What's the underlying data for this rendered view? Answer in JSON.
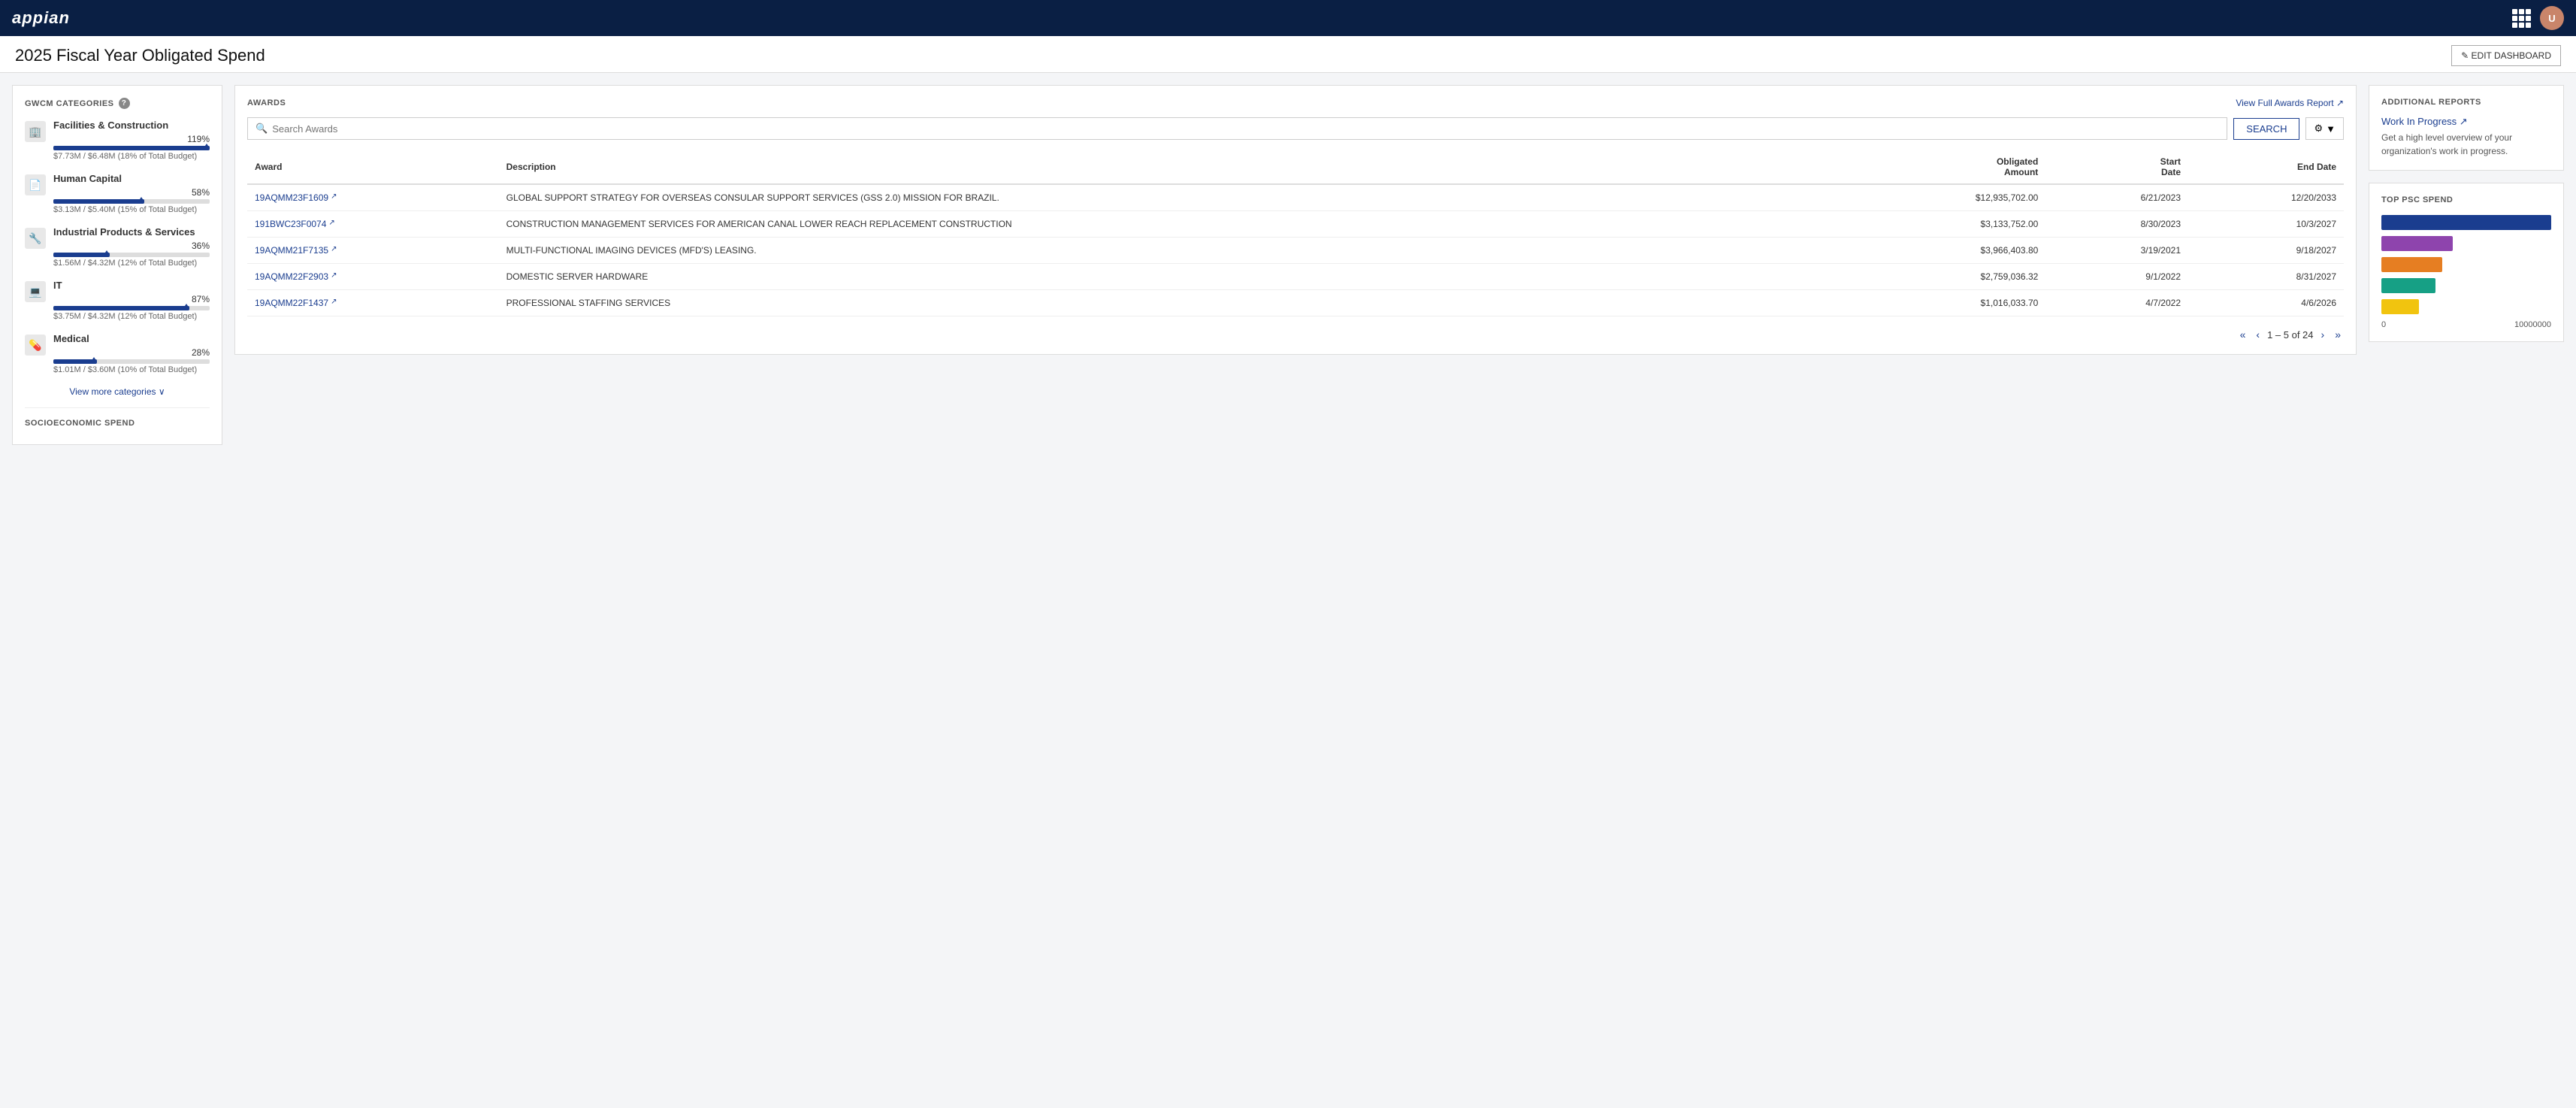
{
  "topnav": {
    "logo": "appian",
    "avatar_initials": "U"
  },
  "page": {
    "title": "2025 Fiscal Year Obligated Spend",
    "edit_dashboard_label": "✎ EDIT DASHBOARD"
  },
  "left_panel": {
    "categories_title": "GWCM CATEGORIES",
    "categories": [
      {
        "icon": "🏢",
        "name": "Facilities & Construction",
        "percent": 119,
        "percent_label": "119%",
        "budget": "$7.73M / $6.48M (18% of Total Budget)"
      },
      {
        "icon": "📄",
        "name": "Human Capital",
        "percent": 58,
        "percent_label": "58%",
        "budget": "$3.13M / $5.40M (15% of Total Budget)"
      },
      {
        "icon": "🔧",
        "name": "Industrial Products & Services",
        "percent": 36,
        "percent_label": "36%",
        "budget": "$1.56M / $4.32M (12% of Total Budget)"
      },
      {
        "icon": "💻",
        "name": "IT",
        "percent": 87,
        "percent_label": "87%",
        "budget": "$3.75M / $4.32M (12% of Total Budget)"
      },
      {
        "icon": "💊",
        "name": "Medical",
        "percent": 28,
        "percent_label": "28%",
        "budget": "$1.01M / $3.60M (10% of Total Budget)"
      }
    ],
    "view_more_label": "View more categories ∨",
    "socio_title": "SOCIOECONOMIC SPEND"
  },
  "awards_panel": {
    "title": "AWARDS",
    "view_full_label": "View Full Awards Report ↗",
    "search_placeholder": "Search Awards",
    "search_button_label": "SEARCH",
    "filter_button_label": "▼",
    "table": {
      "headers": [
        "Award",
        "Description",
        "Obligated Amount",
        "Start Date",
        "End Date"
      ],
      "rows": [
        {
          "award_id": "19AQMM23F1609",
          "description": "GLOBAL SUPPORT STRATEGY FOR OVERSEAS CONSULAR SUPPORT SERVICES (GSS 2.0) MISSION FOR BRAZIL.",
          "obligated_amount": "$12,935,702.00",
          "start_date": "6/21/2023",
          "end_date": "12/20/2033"
        },
        {
          "award_id": "191BWC23F0074",
          "description": "CONSTRUCTION MANAGEMENT SERVICES FOR AMERICAN CANAL LOWER REACH REPLACEMENT CONSTRUCTION",
          "obligated_amount": "$3,133,752.00",
          "start_date": "8/30/2023",
          "end_date": "10/3/2027"
        },
        {
          "award_id": "19AQMM21F7135",
          "description": "MULTI-FUNCTIONAL IMAGING DEVICES (MFD'S) LEASING.",
          "obligated_amount": "$3,966,403.80",
          "start_date": "3/19/2021",
          "end_date": "9/18/2027"
        },
        {
          "award_id": "19AQMM22F2903",
          "description": "DOMESTIC SERVER HARDWARE",
          "obligated_amount": "$2,759,036.32",
          "start_date": "9/1/2022",
          "end_date": "8/31/2027"
        },
        {
          "award_id": "19AQMM22F1437",
          "description": "PROFESSIONAL STAFFING SERVICES",
          "obligated_amount": "$1,016,033.70",
          "start_date": "4/7/2022",
          "end_date": "4/6/2026"
        }
      ]
    },
    "pagination": {
      "current": "1 – 5 of 24"
    }
  },
  "right_panel": {
    "additional_reports_title": "ADDITIONAL REPORTS",
    "wip_label": "Work In Progress ↗",
    "wip_description": "Get a high level overview of your organization's work in progress.",
    "top_psc_title": "TOP PSC SPEND",
    "chart_bars": [
      {
        "color": "#1a3d8f",
        "width_pct": 100
      },
      {
        "color": "#8e44ad",
        "width_pct": 42
      },
      {
        "color": "#e67e22",
        "width_pct": 36
      },
      {
        "color": "#16a085",
        "width_pct": 32
      },
      {
        "color": "#f1c40f",
        "width_pct": 22
      }
    ],
    "chart_axis_min": "0",
    "chart_axis_max": "10000000"
  }
}
